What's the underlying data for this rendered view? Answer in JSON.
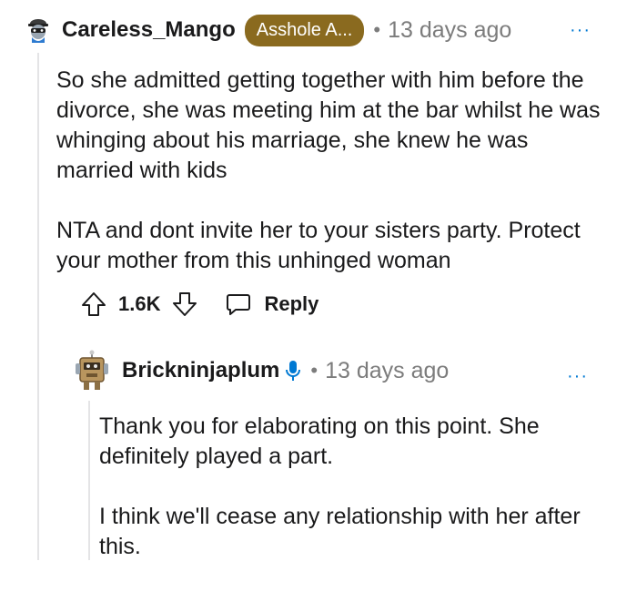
{
  "comment1": {
    "username": "Careless_Mango",
    "flair": "Asshole A...",
    "separator": "•",
    "timestamp": "13 days ago",
    "more": "···",
    "paragraphs": [
      "So she admitted getting together with him before the divorce, she was meeting him at the bar whilst he was whinging about his marriage, she knew he was married with kids",
      "NTA and dont invite her to your sisters party. Protect your mother from this unhinged woman"
    ],
    "score": "1.6K",
    "reply_label": "Reply"
  },
  "comment2": {
    "username": "Brickninjaplum",
    "separator": "•",
    "timestamp": "13 days ago",
    "more": "···",
    "paragraphs": [
      "Thank you for elaborating on this point. She definitely played a part.",
      "I think we'll cease any relationship with her after this."
    ]
  },
  "colors": {
    "flair_bg": "#8a6a1f",
    "accent_blue": "#0079d3",
    "meta_gray": "#7c7c7c",
    "text": "#1a1a1b",
    "thread_line": "#e4e4e6"
  },
  "icons": [
    "bandit-avatar-icon",
    "robot-avatar-icon",
    "upvote-icon",
    "downvote-icon",
    "reply-bubble-icon",
    "microphone-icon",
    "more-options-icon"
  ]
}
